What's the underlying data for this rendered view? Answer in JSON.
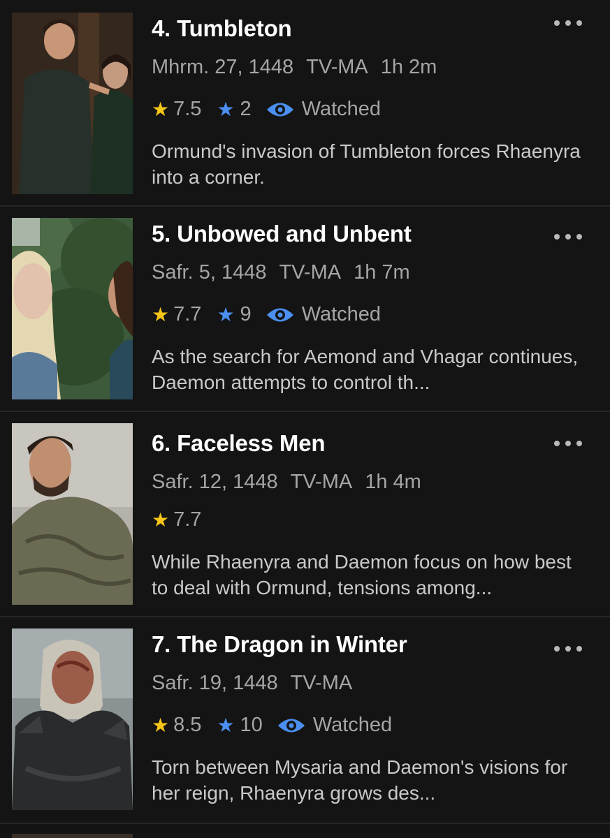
{
  "episodes": [
    {
      "title": "4. Tumbleton",
      "date": "Mhrm. 27, 1448",
      "rating_code": "TV-MA",
      "runtime": "1h 2m",
      "imdb_rating": "7.5",
      "user_rating": "2",
      "status": "Watched",
      "description": "Ormund's invasion of Tumbleton forces Rhaenyra into a corner."
    },
    {
      "title": "5. Unbowed and Unbent",
      "date": "Safr. 5, 1448",
      "rating_code": "TV-MA",
      "runtime": "1h 7m",
      "imdb_rating": "7.7",
      "user_rating": "9",
      "status": "Watched",
      "description": "As the search for Aemond and Vhagar continues, Daemon attempts to control th..."
    },
    {
      "title": "6. Faceless Men",
      "date": "Safr. 12, 1448",
      "rating_code": "TV-MA",
      "runtime": "1h 4m",
      "imdb_rating": "7.7",
      "description": "While Rhaenyra and Daemon focus on how best to deal with Ormund, tensions among..."
    },
    {
      "title": "7. The Dragon in Winter",
      "date": "Safr. 19, 1448",
      "rating_code": "TV-MA",
      "imdb_rating": "8.5",
      "user_rating": "10",
      "status": "Watched",
      "description": "Torn between Mysaria and Daemon's visions for her reign, Rhaenyra grows des..."
    }
  ],
  "icons": {
    "imdb_star": "star-icon",
    "user_star": "user-rating-star-icon",
    "watched": "eye-icon",
    "more": "more-options-icon"
  },
  "colors": {
    "background": "#141414",
    "title": "#ffffff",
    "meta": "#a5a5a5",
    "imdb_star": "#f5c518",
    "accent_blue": "#4b8ff0"
  }
}
